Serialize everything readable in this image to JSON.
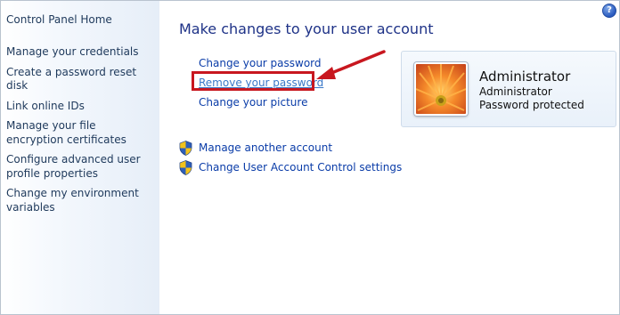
{
  "sidebar": {
    "home_label": "Control Panel Home",
    "items": [
      {
        "label": "Manage your credentials"
      },
      {
        "label": "Create a password reset disk"
      },
      {
        "label": "Link online IDs"
      },
      {
        "label": "Manage your file encryption certificates"
      },
      {
        "label": "Configure advanced user profile properties"
      },
      {
        "label": "Change my environment variables"
      }
    ]
  },
  "main": {
    "title": "Make changes to your user account",
    "tasks": {
      "change_password": "Change your password",
      "remove_password": "Remove your password",
      "change_picture": "Change your picture"
    },
    "shield_tasks": {
      "manage_another": "Manage another account",
      "uac_settings": "Change User Account Control settings"
    }
  },
  "account": {
    "name": "Administrator",
    "type": "Administrator",
    "status": "Password protected"
  },
  "help": {
    "label": "?"
  },
  "colors": {
    "link": "#0a3ca8",
    "title": "#1e3287",
    "highlight": "#c8171f"
  }
}
